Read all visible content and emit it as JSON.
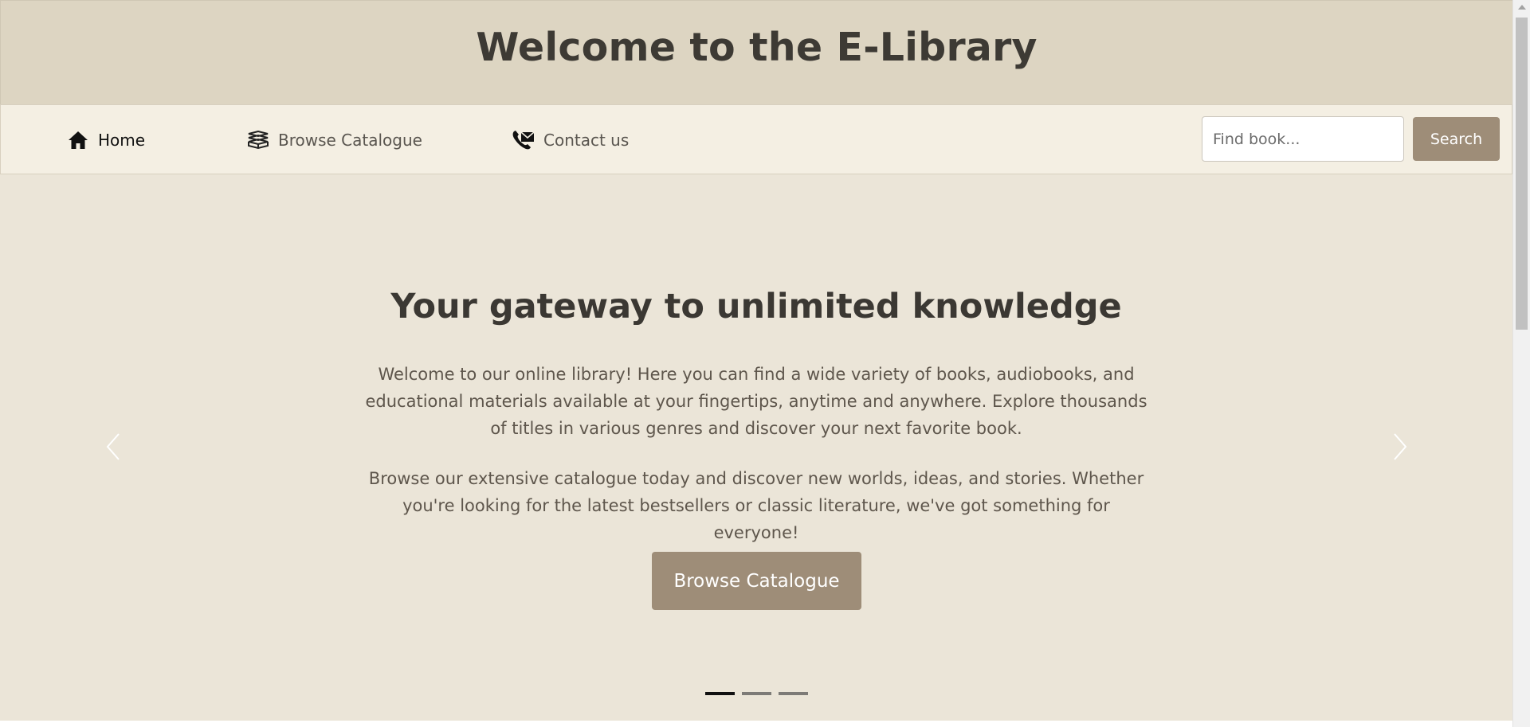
{
  "header": {
    "title": "Welcome to the E-Library"
  },
  "nav": {
    "items": [
      {
        "label": "Home",
        "icon": "home-icon",
        "active": true
      },
      {
        "label": "Browse Catalogue",
        "icon": "books-icon",
        "active": false
      },
      {
        "label": "Contact us",
        "icon": "contact-icon",
        "active": false
      }
    ],
    "search": {
      "placeholder": "Find book...",
      "value": "",
      "button_label": "Search"
    }
  },
  "hero": {
    "heading": "Your gateway to unlimited knowledge",
    "paragraph1": "Welcome to our online library! Here you can find a wide variety of books, audiobooks, and educational materials available at your fingertips, anytime and anywhere. Explore thousands of titles in various genres and discover your next favorite book.",
    "paragraph2": "Browse our extensive catalogue today and discover new worlds, ideas, and stories. Whether you're looking for the latest bestsellers or classic literature, we've got something for everyone!",
    "cta_label": "Browse Catalogue",
    "slides": 3,
    "active_slide": 1
  },
  "colors": {
    "header_bg": "#ddd5c2",
    "nav_bg": "#f4efe3",
    "hero_bg": "#ebe5d8",
    "accent": "#9e8d78",
    "title_text": "#3d3a34"
  }
}
